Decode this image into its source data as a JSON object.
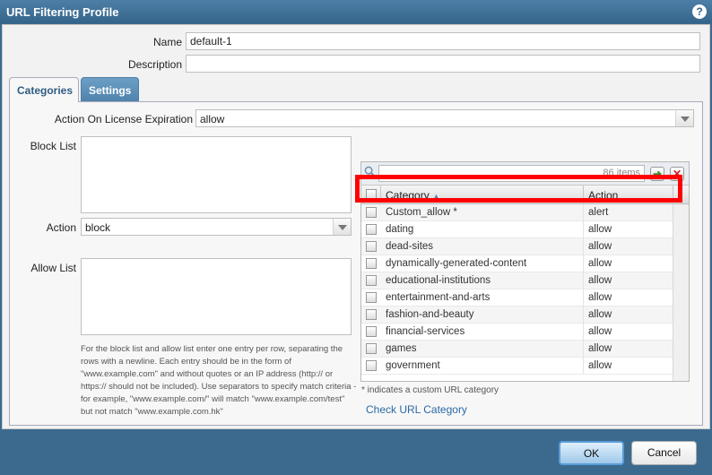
{
  "window": {
    "title": "URL Filtering Profile"
  },
  "form": {
    "name_label": "Name",
    "name_value": "default-1",
    "description_label": "Description",
    "description_value": ""
  },
  "tabs": [
    {
      "label": "Categories",
      "active": true
    },
    {
      "label": "Settings",
      "active": false
    }
  ],
  "categories_tab": {
    "license_label": "Action On License Expiration",
    "license_value": "allow",
    "block_list_label": "Block List",
    "action_label": "Action",
    "action_value": "block",
    "allow_list_label": "Allow List",
    "help_text": "For the block list and allow list enter one entry per row, separating the rows with a newline. Each entry should be in the form of \"www.example.com\" and without quotes or an IP address (http:// or https:// should not be included). Use separators to specify match criteria - for example, \"www.example.com/\" will match \"www.example.com/test\" but not match \"www.example.com.hk\""
  },
  "grid": {
    "items_count": "86 items",
    "columns": {
      "category": "Category",
      "action": "Action"
    },
    "rows": [
      {
        "category": "Custom_allow *",
        "action": "alert"
      },
      {
        "category": "dating",
        "action": "allow"
      },
      {
        "category": "dead-sites",
        "action": "allow"
      },
      {
        "category": "dynamically-generated-content",
        "action": "allow"
      },
      {
        "category": "educational-institutions",
        "action": "allow"
      },
      {
        "category": "entertainment-and-arts",
        "action": "allow"
      },
      {
        "category": "fashion-and-beauty",
        "action": "allow"
      },
      {
        "category": "financial-services",
        "action": "allow"
      },
      {
        "category": "games",
        "action": "allow"
      },
      {
        "category": "government",
        "action": "allow"
      }
    ],
    "note": "* indicates a custom URL category",
    "check_link": "Check URL Category"
  },
  "footer": {
    "ok_label": "OK",
    "cancel_label": "Cancel"
  },
  "colors": {
    "accent": "#35648a",
    "highlight": "#ff0000",
    "link": "#2a6aa5"
  }
}
